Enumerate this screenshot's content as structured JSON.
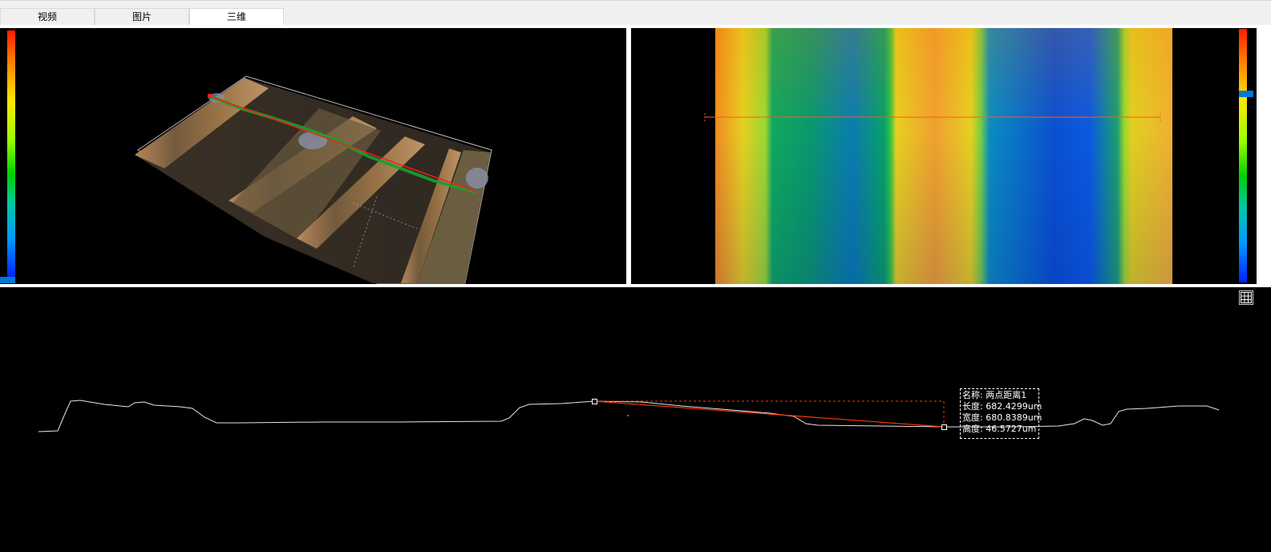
{
  "tabs": [
    {
      "label": "视频"
    },
    {
      "label": "图片"
    },
    {
      "label": "三维",
      "active": true
    }
  ],
  "measurement": {
    "name_label": "名称:",
    "name_value": "两点距离1",
    "length_label": "长度:",
    "length_value": "682.4299um",
    "width_label": "宽度:",
    "width_value": "680.8389um",
    "height_label": "高度:",
    "height_value": "46.5727um"
  },
  "colors": {
    "accent": "#0078d7",
    "measure_line": "#ff3a00",
    "profile_line": "#e6e6e6"
  },
  "icons": {
    "grid_toggle": "grid-icon"
  }
}
